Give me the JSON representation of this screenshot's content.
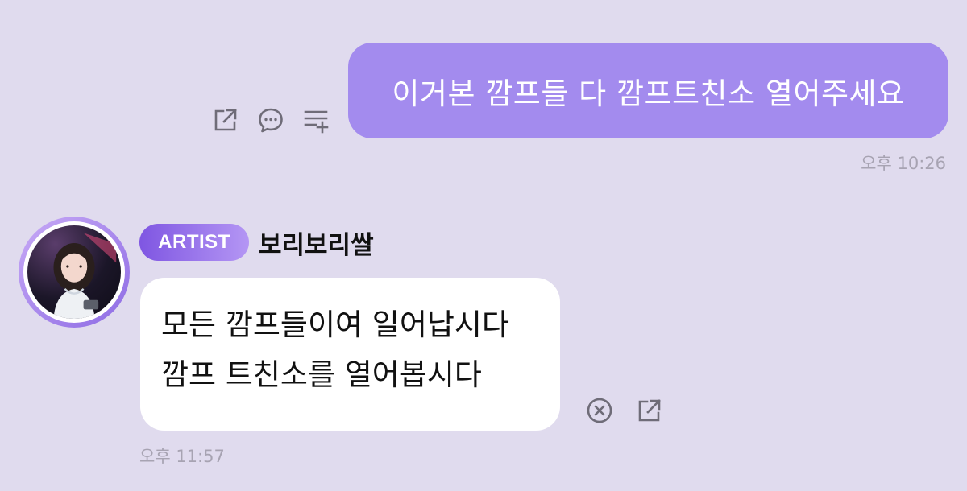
{
  "colors": {
    "background": "#e0dbee",
    "outgoing_bubble": "#a38bee",
    "incoming_bubble": "#ffffff",
    "timestamp": "#a7a3b2",
    "badge_start": "#7f56e2",
    "badge_end": "#b496f4",
    "icon": "#6f6c78"
  },
  "outgoing_message": {
    "text": "이거본 깜프들 다 깜프트친소 열어주세요",
    "time": "오후 10:26",
    "actions": [
      {
        "icon": "share-icon"
      },
      {
        "icon": "reply-bubble-icon"
      },
      {
        "icon": "add-to-list-icon"
      }
    ]
  },
  "incoming_message": {
    "badge": "ARTIST",
    "sender": "보리보리쌀",
    "lines": [
      "모든 깜프들이여 일어납시다",
      "깜프 트친소를 열어봅시다"
    ],
    "time": "오후 11:57",
    "actions": [
      {
        "icon": "close-circle-icon"
      },
      {
        "icon": "share-icon"
      }
    ]
  }
}
